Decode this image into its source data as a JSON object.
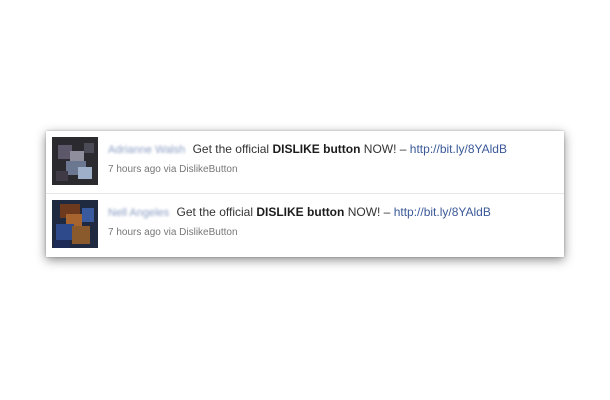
{
  "stories": [
    {
      "actor_name": "Adrianne Walsh",
      "text_before": "Get the official",
      "keyword_1": "DISLIKE",
      "keyword_2": "button",
      "text_after": "NOW! –",
      "link": "http://bit.ly/8YAldB",
      "timestamp": "7 hours ago via DislikeButton"
    },
    {
      "actor_name": "Nell Angeles",
      "text_before": "Get the official",
      "keyword_1": "DISLIKE",
      "keyword_2": "button",
      "text_after": "NOW! –",
      "link": "http://bit.ly/8YAldB",
      "timestamp": "7 hours ago via DislikeButton"
    }
  ],
  "colors": {
    "link": "#3b5998",
    "actor_name_blurred": "#8b9dc3",
    "meta_text": "#777777"
  }
}
